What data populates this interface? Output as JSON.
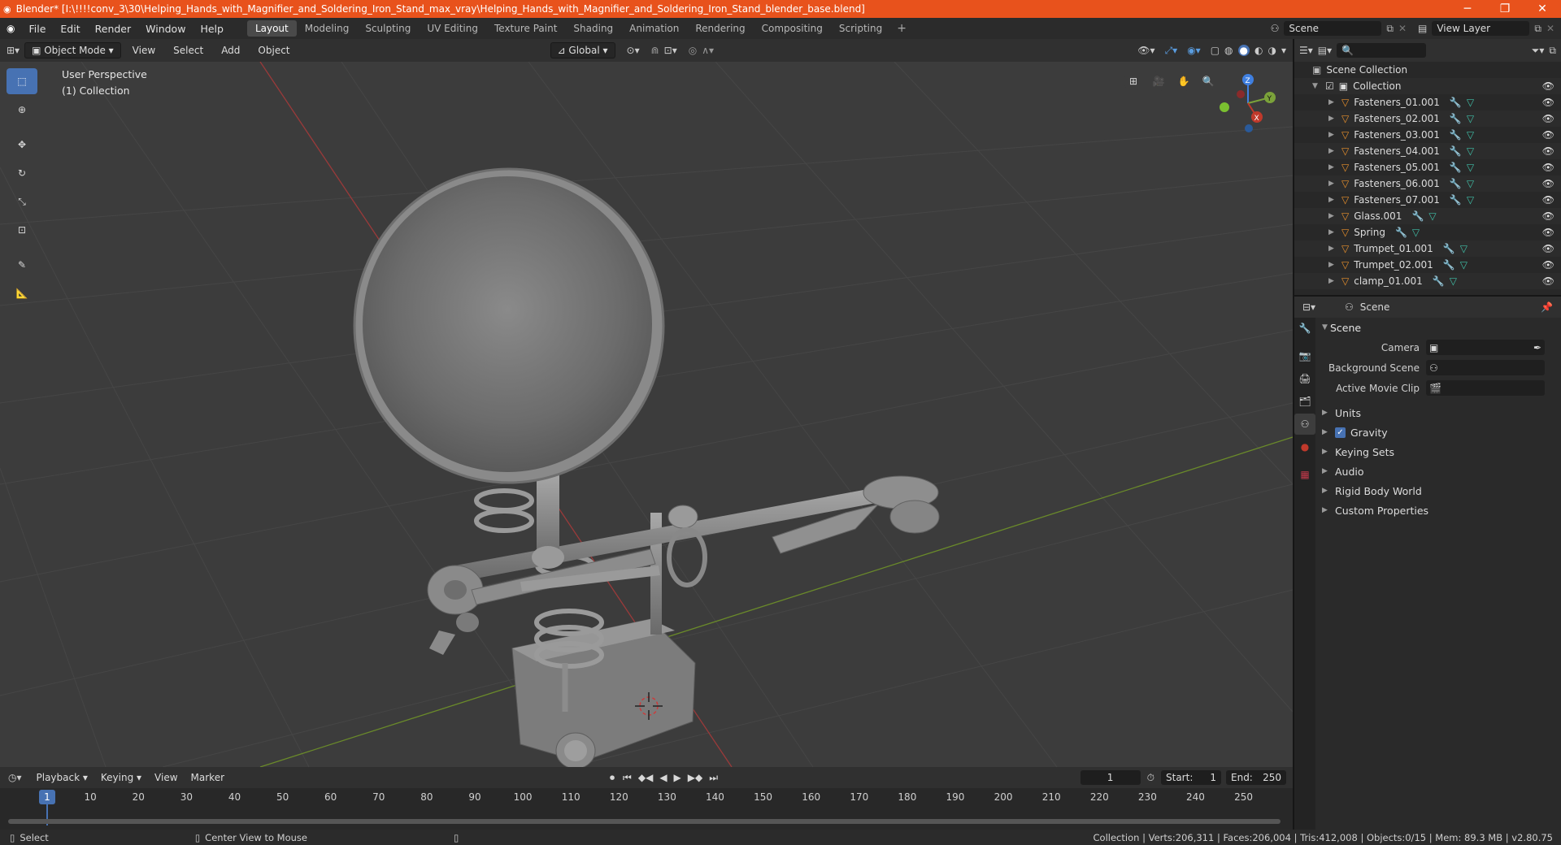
{
  "window": {
    "title": "Blender* [I:\\!!!!conv_3\\30\\Helping_Hands_with_Magnifier_and_Soldering_Iron_Stand_max_vray\\Helping_Hands_with_Magnifier_and_Soldering_Iron_Stand_blender_base.blend]"
  },
  "menu": [
    "File",
    "Edit",
    "Render",
    "Window",
    "Help"
  ],
  "workspaces": [
    "Layout",
    "Modeling",
    "Sculpting",
    "UV Editing",
    "Texture Paint",
    "Shading",
    "Animation",
    "Rendering",
    "Compositing",
    "Scripting"
  ],
  "active_workspace": "Layout",
  "scene_field": "Scene",
  "view_layer_field": "View Layer",
  "viewport_header": {
    "mode": "Object Mode",
    "view": "View",
    "select": "Select",
    "add": "Add",
    "object": "Object",
    "transform": "Global"
  },
  "viewport": {
    "perspective": "User Perspective",
    "collection": "(1) Collection"
  },
  "outliner": {
    "root": "Scene Collection",
    "collection": "Collection",
    "items": [
      "Fasteners_01.001",
      "Fasteners_02.001",
      "Fasteners_03.001",
      "Fasteners_04.001",
      "Fasteners_05.001",
      "Fasteners_06.001",
      "Fasteners_07.001",
      "Glass.001",
      "Spring",
      "Trumpet_01.001",
      "Trumpet_02.001",
      "clamp_01.001"
    ]
  },
  "properties": {
    "context": "Scene",
    "panel": "Scene",
    "camera_label": "Camera",
    "background_label": "Background Scene",
    "movie_clip_label": "Active Movie Clip",
    "subpanels": [
      "Units",
      "Gravity",
      "Keying Sets",
      "Audio",
      "Rigid Body World",
      "Custom Properties"
    ]
  },
  "timeline": {
    "playback": "Playback",
    "keying": "Keying",
    "view": "View",
    "marker": "Marker",
    "current_frame": "1",
    "start_label": "Start:",
    "start": "1",
    "end_label": "End:",
    "end": "250",
    "frame_labels": [
      "1",
      "10",
      "20",
      "30",
      "40",
      "50",
      "60",
      "70",
      "80",
      "90",
      "100",
      "110",
      "120",
      "130",
      "140",
      "150",
      "160",
      "170",
      "180",
      "190",
      "200",
      "210",
      "220",
      "230",
      "240",
      "250"
    ]
  },
  "statusbar": {
    "select": "Select",
    "center_view": "Center View to Mouse",
    "stats": "Collection | Verts:206,311 | Faces:206,004 | Tris:412,008 | Objects:0/15 | Mem: 89.3 MB | v2.80.75"
  },
  "colors": {
    "titlebar": "#e8521c",
    "active_tool": "#4772b3",
    "x_axis": "#c0392b",
    "y_axis": "#7ba23a",
    "z_axis": "#3f7fe0",
    "outliner_icon": "#e8902c",
    "modifier_icon": "#6aa0e8",
    "mesh_icon": "#40c0a8"
  }
}
